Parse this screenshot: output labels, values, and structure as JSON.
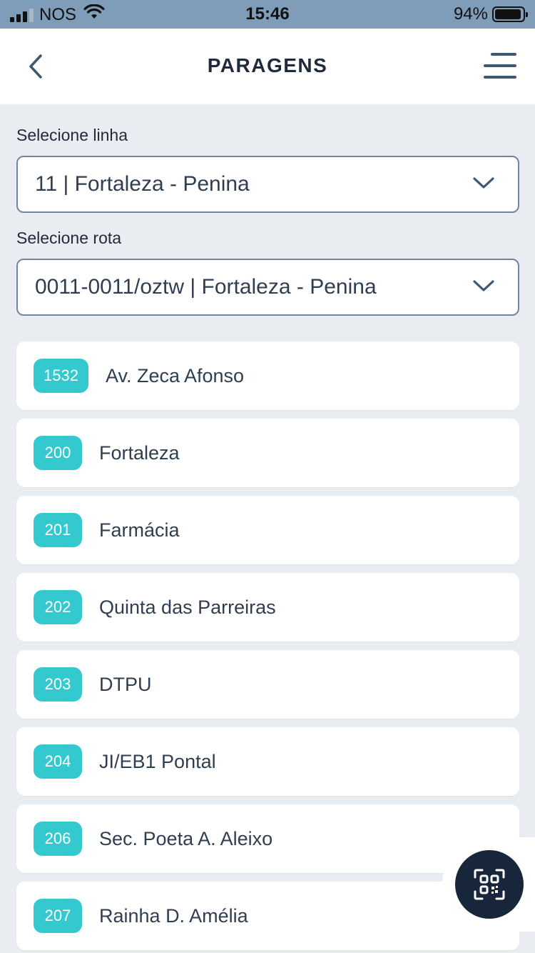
{
  "status_bar": {
    "carrier": "NOS",
    "time": "15:46",
    "battery": "94%",
    "battery_level": 0.94
  },
  "header": {
    "title": "PARAGENS",
    "back_icon": "chevron-left-icon",
    "menu_icon": "menu-icon"
  },
  "line_select": {
    "label": "Selecione linha",
    "value": "11 | Fortaleza - Penina"
  },
  "route_select": {
    "label": "Selecione rota",
    "value": "0011-0011/oztw | Fortaleza - Penina"
  },
  "stops": [
    {
      "code": "1532",
      "name": "Av. Zeca Afonso"
    },
    {
      "code": "200",
      "name": "Fortaleza"
    },
    {
      "code": "201",
      "name": "Farmácia"
    },
    {
      "code": "202",
      "name": "Quinta das Parreiras"
    },
    {
      "code": "203",
      "name": "DTPU"
    },
    {
      "code": "204",
      "name": "JI/EB1 Pontal"
    },
    {
      "code": "206",
      "name": "Sec. Poeta A. Aleixo"
    },
    {
      "code": "207",
      "name": "Rainha D. Amélia"
    }
  ],
  "fab": {
    "icon": "qr-scan-icon"
  },
  "colors": {
    "status_bar": "#7f9cb9",
    "background": "#e9edf2",
    "badge": "#33c9cf",
    "fab": "#17263a",
    "select_border": "#6f86a0"
  }
}
